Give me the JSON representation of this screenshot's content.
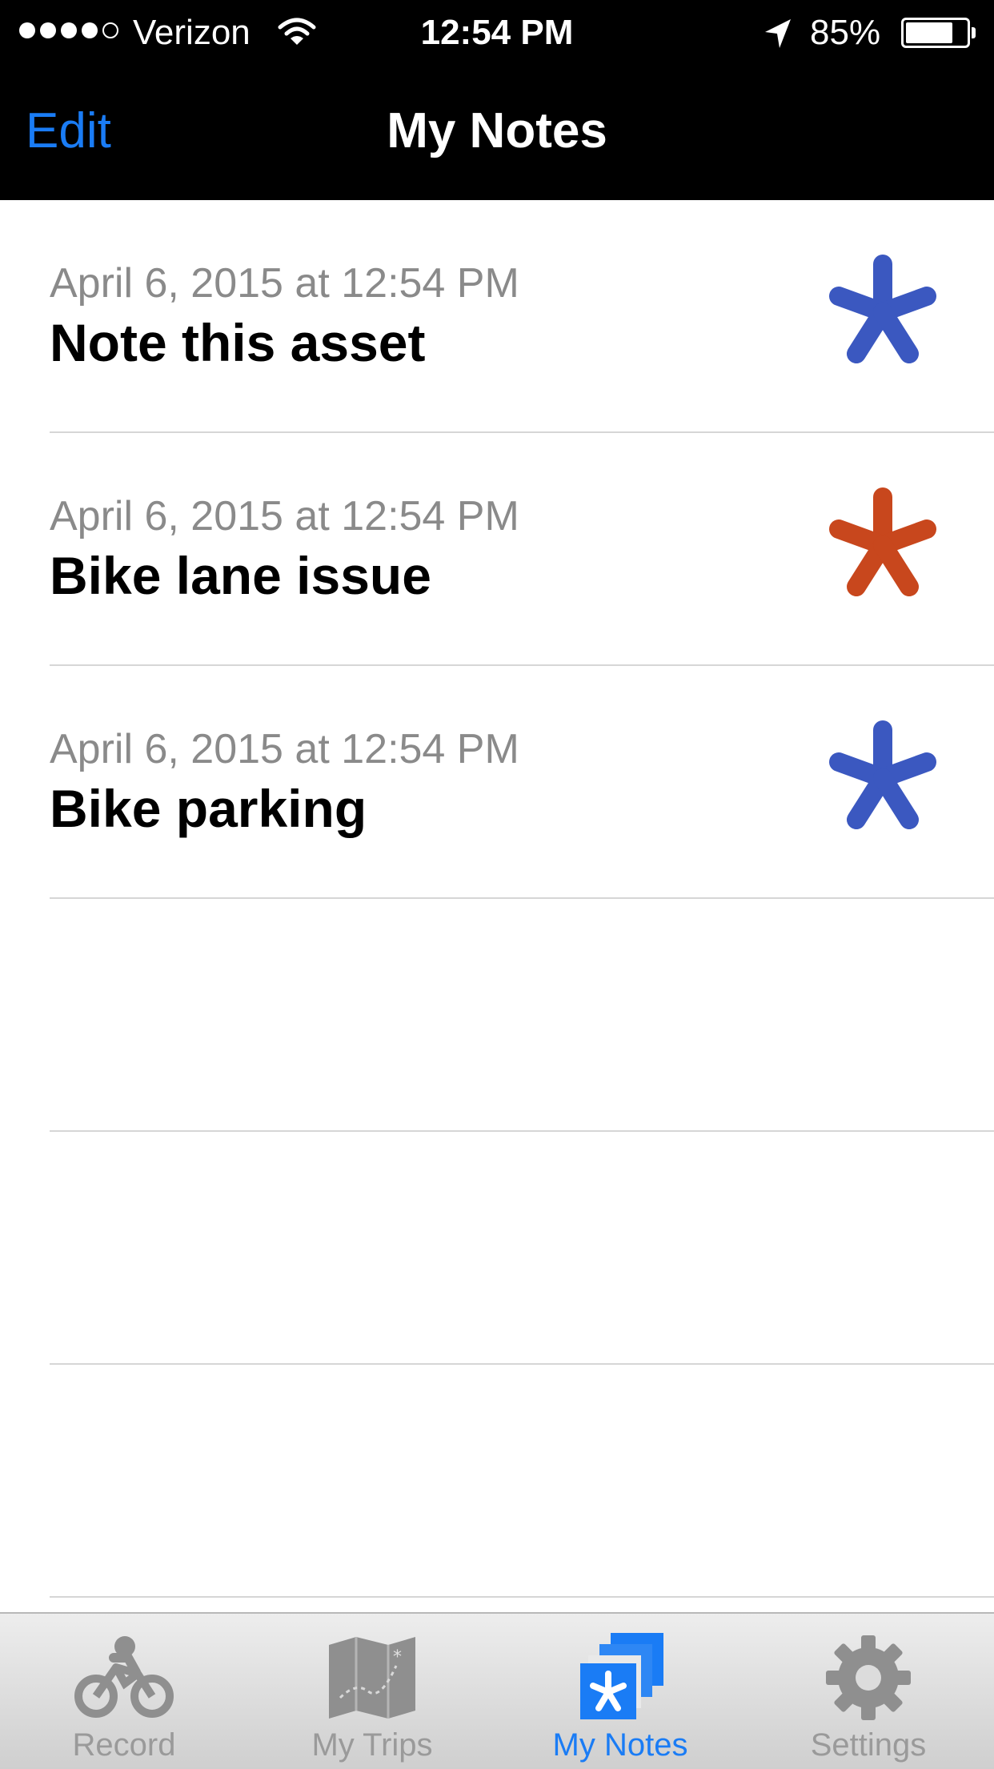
{
  "status_bar": {
    "carrier": "Verizon",
    "time": "12:54 PM",
    "battery": "85%",
    "signal_bars_filled": 4,
    "signal_bars_total": 5
  },
  "nav": {
    "edit_label": "Edit",
    "title": "My Notes"
  },
  "notes": [
    {
      "date": "April 6, 2015 at 12:54 PM",
      "title": "Note this asset",
      "icon": "asterisk-icon",
      "color": "#3b58c0"
    },
    {
      "date": "April 6, 2015 at 12:54 PM",
      "title": "Bike lane issue",
      "icon": "asterisk-icon",
      "color": "#c8471d"
    },
    {
      "date": "April 6, 2015 at 12:54 PM",
      "title": "Bike parking",
      "icon": "asterisk-icon",
      "color": "#3b58c0"
    }
  ],
  "tabs": [
    {
      "label": "Record",
      "icon": "bicycle-rider-icon",
      "active": false
    },
    {
      "label": "My Trips",
      "icon": "map-icon",
      "active": false
    },
    {
      "label": "My Notes",
      "icon": "notes-stack-icon",
      "active": true
    },
    {
      "label": "Settings",
      "icon": "gear-icon",
      "active": false
    }
  ],
  "colors": {
    "accent": "#1a7cf5",
    "bar_background": "#000000",
    "note_blue": "#3b58c0",
    "note_orange": "#c8471d"
  }
}
